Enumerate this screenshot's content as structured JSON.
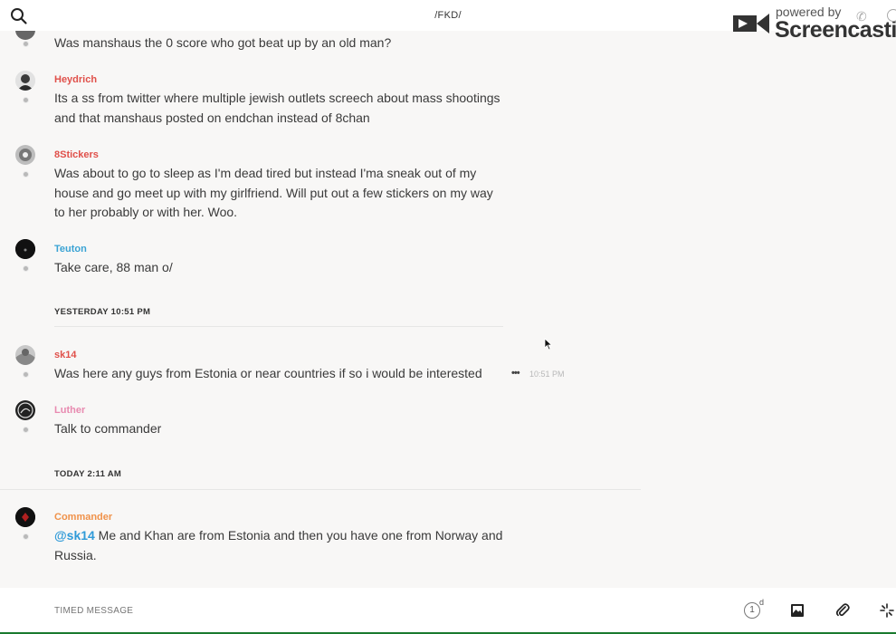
{
  "header": {
    "room_title": "/FKD/"
  },
  "watermark": {
    "powered_by": "powered by",
    "brand": "Screencastify"
  },
  "messages": [
    {
      "username": "",
      "text": "Was manshaus the 0 score who got beat up by an old man?"
    },
    {
      "username": "Heydrich",
      "text": "Its a ss from twitter where multiple jewish outlets screech about mass shootings and that manshaus posted on endchan instead of 8chan"
    },
    {
      "username": "8Stickers",
      "text": "Was about to go to sleep as I'm dead tired but instead I'ma sneak out of my house and go meet up with my girlfriend. Will put out a few stickers on my way to her probably or with her. Woo."
    },
    {
      "username": "Teuton",
      "text": "Take care, 88 man o/"
    },
    {
      "username": "sk14",
      "text": "Was here any guys from Estonia or near countries if so i would be interested",
      "time": "10:51 PM",
      "more": "•••"
    },
    {
      "username": "Luther",
      "text": "Talk to commander"
    },
    {
      "username": "Commander",
      "mention": "@sk14",
      "text": " Me and Khan are from Estonia and then you have one from Norway and Russia."
    }
  ],
  "day_separators": [
    {
      "label": "YESTERDAY 10:51 PM"
    },
    {
      "label": "TODAY 2:11 AM"
    }
  ],
  "composer": {
    "placeholder": "TIMED MESSAGE",
    "timer_value": "1",
    "timer_unit": "d"
  },
  "colors": {
    "heydrich": "#e0504a",
    "stickers": "#e0504a",
    "teuton": "#3aa3d4",
    "sk14": "#e0504a",
    "luther": "#e88ab0",
    "commander": "#f0924a",
    "mention": "#2f9ad8"
  }
}
